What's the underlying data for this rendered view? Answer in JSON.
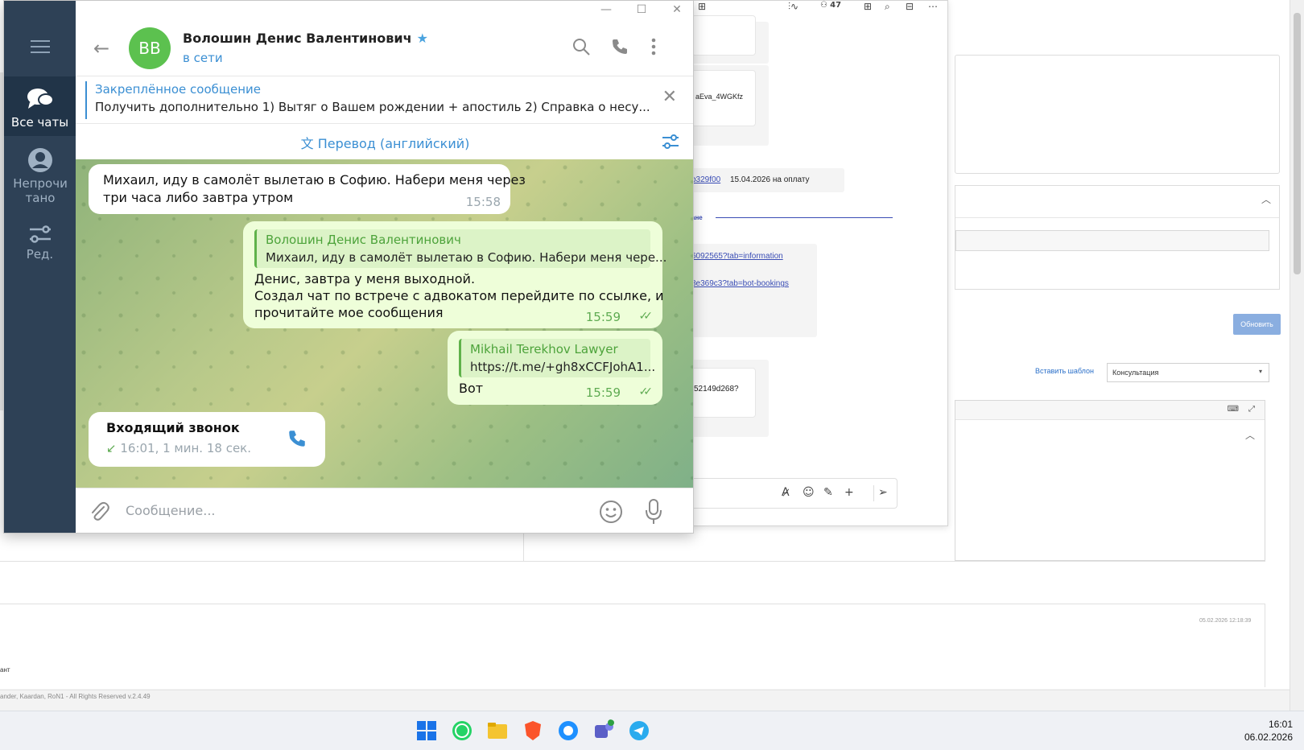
{
  "telegram": {
    "sidebar": {
      "items": [
        {
          "label": "Все чаты"
        },
        {
          "label": "Непрочитано"
        },
        {
          "label": "Ред."
        }
      ]
    },
    "header": {
      "avatar_initials": "ВВ",
      "name": "Волошин Денис Валентинович",
      "status": "в сети"
    },
    "pinned": {
      "title": "Закреплённое сообщение",
      "text": "Получить дополнительно  1) Вытяг о Вашем рождении + апостиль 2) Справка о несу..."
    },
    "translate_label": "Перевод (английский)",
    "messages": {
      "m1": {
        "text_line1": "Михаил, иду в самолёт вылетаю в Софию. Набери меня через",
        "text_line2": "три часа либо завтра утром",
        "time": "15:58"
      },
      "m2": {
        "reply_name": "Волошин Денис Валентинович",
        "reply_text": "Михаил, иду в самолёт вылетаю в Софию. Набери меня чере...",
        "line1": "Денис, завтра у меня выходной.",
        "line2": "Создал чат по встрече с адвокатом перейдите по ссылке, и",
        "line3": "прочитайте мое сообщения",
        "time": "15:59"
      },
      "m3": {
        "reply_name": "Mikhail Terekhov Lawyer",
        "reply_text": "https://t.me/+gh8xCCFJohA1...",
        "text": "Вот",
        "time": "15:59"
      },
      "call": {
        "title": "Входящий звонок",
        "detail": "16:01, 1 мин. 18 сек."
      }
    },
    "input_placeholder": "Сообщение..."
  },
  "middle_window": {
    "file_name": "aEva_4WGKfz",
    "invoice_link": "b329f00",
    "invoice_text": "15.04.2026 на оплату",
    "tab_label": "ане",
    "link1": "6092565?tab=information",
    "link2": "8e369c3?tab=bot-bookings",
    "hash_text": "52149d268?",
    "top_count": "47"
  },
  "background_app": {
    "update_button": "Обновить",
    "insert_template_link": "Вставить шаблон",
    "template_select": "Консультация",
    "timestamp": "05.02.2026 12:18:39",
    "fragment": "ант",
    "footer": "ander, Kaardan, RoN1 - All Rights Reserved v.2.4.49"
  },
  "taskbar": {
    "time": "16:01",
    "date": "06.02.2026"
  },
  "colors": {
    "telegram_sidebar": "#2e4156",
    "telegram_accent": "#3b8fd3",
    "outgoing_bubble": "#eefed9",
    "avatar": "#5cc14f"
  }
}
